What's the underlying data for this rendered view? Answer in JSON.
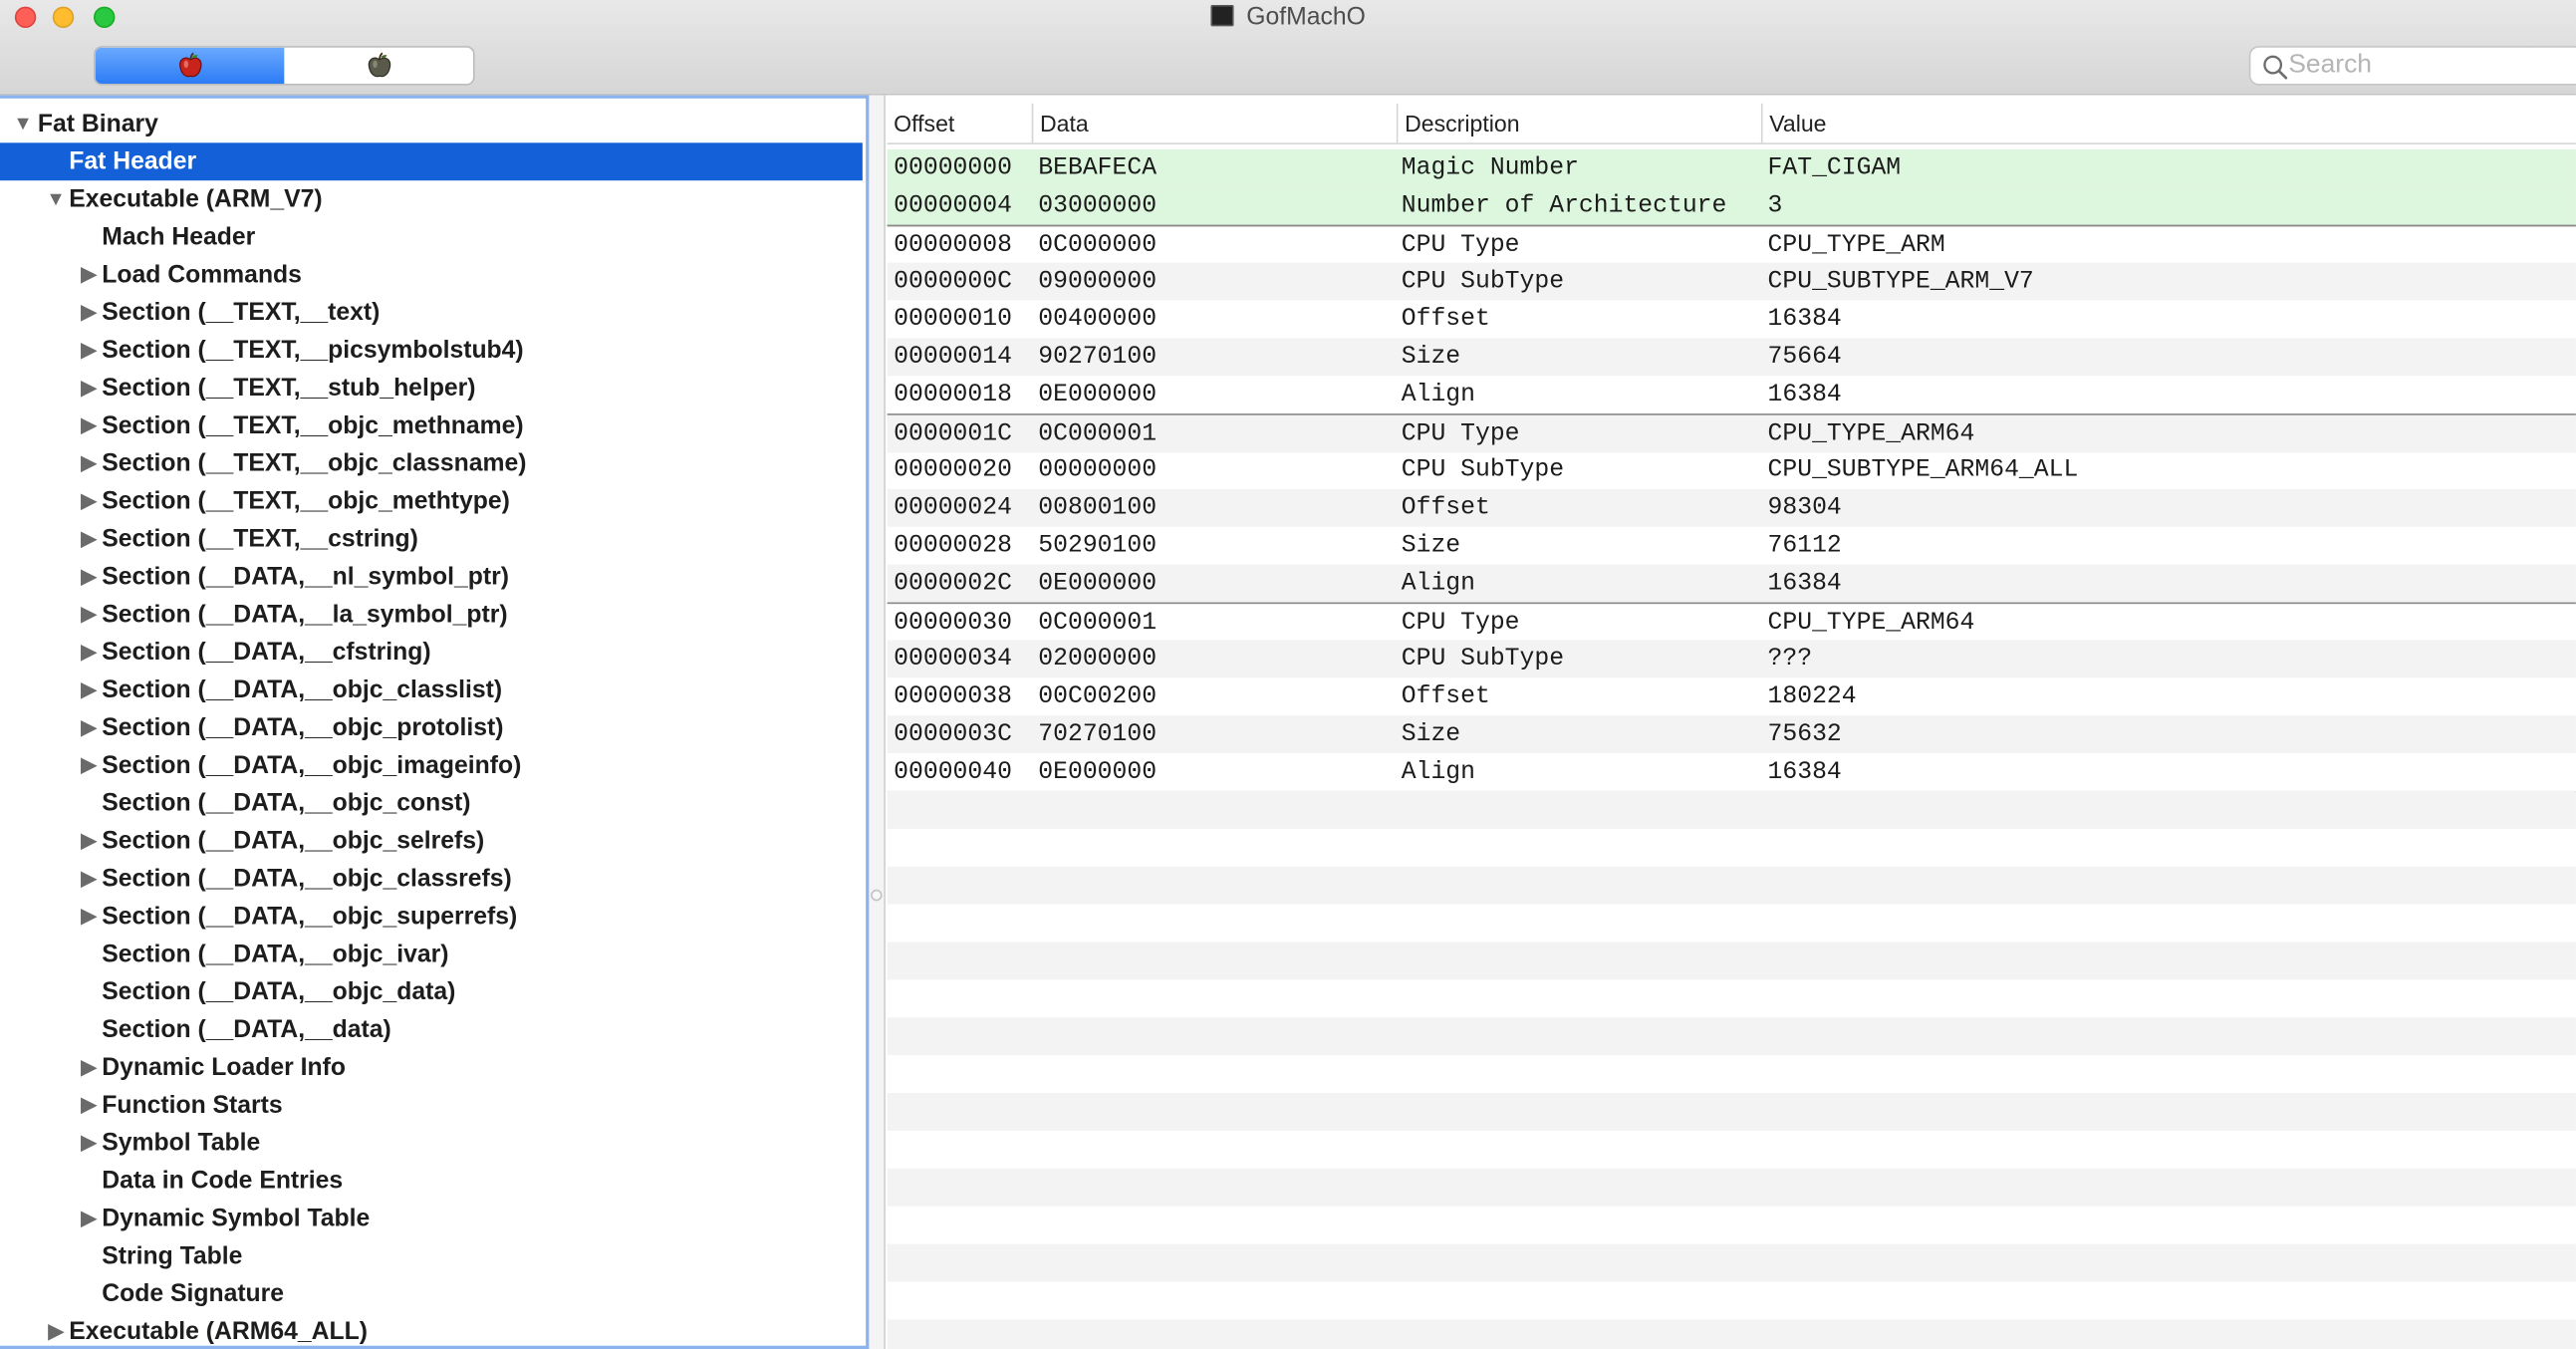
{
  "window": {
    "title": "GofMachO"
  },
  "toolbar": {
    "segments": [
      {
        "name": "red-apple-icon",
        "active": true
      },
      {
        "name": "dark-apple-icon",
        "active": false
      }
    ],
    "search": {
      "value": "",
      "placeholder": "Search"
    }
  },
  "colors": {
    "selection": "#1460d8",
    "highlight_row": "#dcf7dd",
    "segment_active": "#2c7cf6"
  },
  "tree": [
    {
      "label": "Fat Binary",
      "depth": 0,
      "disclosure": "expanded"
    },
    {
      "label": "Fat Header",
      "depth": 1,
      "disclosure": "none",
      "selected": true
    },
    {
      "label": "Executable  (ARM_V7)",
      "depth": 1,
      "disclosure": "expanded"
    },
    {
      "label": "Mach Header",
      "depth": 2,
      "disclosure": "none"
    },
    {
      "label": "Load Commands",
      "depth": 2,
      "disclosure": "collapsed"
    },
    {
      "label": "Section (__TEXT,__text)",
      "depth": 2,
      "disclosure": "collapsed"
    },
    {
      "label": "Section (__TEXT,__picsymbolstub4)",
      "depth": 2,
      "disclosure": "collapsed"
    },
    {
      "label": "Section (__TEXT,__stub_helper)",
      "depth": 2,
      "disclosure": "collapsed"
    },
    {
      "label": "Section (__TEXT,__objc_methname)",
      "depth": 2,
      "disclosure": "collapsed"
    },
    {
      "label": "Section (__TEXT,__objc_classname)",
      "depth": 2,
      "disclosure": "collapsed"
    },
    {
      "label": "Section (__TEXT,__objc_methtype)",
      "depth": 2,
      "disclosure": "collapsed"
    },
    {
      "label": "Section (__TEXT,__cstring)",
      "depth": 2,
      "disclosure": "collapsed"
    },
    {
      "label": "Section (__DATA,__nl_symbol_ptr)",
      "depth": 2,
      "disclosure": "collapsed"
    },
    {
      "label": "Section (__DATA,__la_symbol_ptr)",
      "depth": 2,
      "disclosure": "collapsed"
    },
    {
      "label": "Section (__DATA,__cfstring)",
      "depth": 2,
      "disclosure": "collapsed"
    },
    {
      "label": "Section (__DATA,__objc_classlist)",
      "depth": 2,
      "disclosure": "collapsed"
    },
    {
      "label": "Section (__DATA,__objc_protolist)",
      "depth": 2,
      "disclosure": "collapsed"
    },
    {
      "label": "Section (__DATA,__objc_imageinfo)",
      "depth": 2,
      "disclosure": "collapsed"
    },
    {
      "label": "Section (__DATA,__objc_const)",
      "depth": 2,
      "disclosure": "none"
    },
    {
      "label": "Section (__DATA,__objc_selrefs)",
      "depth": 2,
      "disclosure": "collapsed"
    },
    {
      "label": "Section (__DATA,__objc_classrefs)",
      "depth": 2,
      "disclosure": "collapsed"
    },
    {
      "label": "Section (__DATA,__objc_superrefs)",
      "depth": 2,
      "disclosure": "collapsed"
    },
    {
      "label": "Section (__DATA,__objc_ivar)",
      "depth": 2,
      "disclosure": "none"
    },
    {
      "label": "Section (__DATA,__objc_data)",
      "depth": 2,
      "disclosure": "none"
    },
    {
      "label": "Section (__DATA,__data)",
      "depth": 2,
      "disclosure": "none"
    },
    {
      "label": "Dynamic Loader Info",
      "depth": 2,
      "disclosure": "collapsed"
    },
    {
      "label": "Function Starts",
      "depth": 2,
      "disclosure": "collapsed"
    },
    {
      "label": "Symbol Table",
      "depth": 2,
      "disclosure": "collapsed"
    },
    {
      "label": "Data in Code Entries",
      "depth": 2,
      "disclosure": "none"
    },
    {
      "label": "Dynamic Symbol Table",
      "depth": 2,
      "disclosure": "collapsed"
    },
    {
      "label": "String Table",
      "depth": 2,
      "disclosure": "none"
    },
    {
      "label": "Code Signature",
      "depth": 2,
      "disclosure": "none"
    },
    {
      "label": "Executable  (ARM64_ALL)",
      "depth": 1,
      "disclosure": "collapsed"
    }
  ],
  "table": {
    "columns": [
      "Offset",
      "Data",
      "Description",
      "Value"
    ],
    "rows": [
      {
        "offset": "00000000",
        "data": "BEBAFECA",
        "description": "Magic Number",
        "value": "FAT_CIGAM",
        "highlight": true
      },
      {
        "offset": "00000004",
        "data": "03000000",
        "description": "Number of Architecture",
        "value": "3",
        "highlight": true
      },
      {
        "offset": "00000008",
        "data": "0C000000",
        "description": "CPU Type",
        "value": "CPU_TYPE_ARM"
      },
      {
        "offset": "0000000C",
        "data": "09000000",
        "description": "CPU SubType",
        "value": "CPU_SUBTYPE_ARM_V7"
      },
      {
        "offset": "00000010",
        "data": "00400000",
        "description": "Offset",
        "value": "16384"
      },
      {
        "offset": "00000014",
        "data": "90270100",
        "description": "Size",
        "value": "75664"
      },
      {
        "offset": "00000018",
        "data": "0E000000",
        "description": "Align",
        "value": "16384"
      },
      {
        "offset": "0000001C",
        "data": "0C000001",
        "description": "CPU Type",
        "value": "CPU_TYPE_ARM64"
      },
      {
        "offset": "00000020",
        "data": "00000000",
        "description": "CPU SubType",
        "value": "CPU_SUBTYPE_ARM64_ALL"
      },
      {
        "offset": "00000024",
        "data": "00800100",
        "description": "Offset",
        "value": "98304"
      },
      {
        "offset": "00000028",
        "data": "50290100",
        "description": "Size",
        "value": "76112"
      },
      {
        "offset": "0000002C",
        "data": "0E000000",
        "description": "Align",
        "value": "16384"
      },
      {
        "offset": "00000030",
        "data": "0C000001",
        "description": "CPU Type",
        "value": "CPU_TYPE_ARM64"
      },
      {
        "offset": "00000034",
        "data": "02000000",
        "description": "CPU SubType",
        "value": "???"
      },
      {
        "offset": "00000038",
        "data": "00C00200",
        "description": "Offset",
        "value": "180224"
      },
      {
        "offset": "0000003C",
        "data": "70270100",
        "description": "Size",
        "value": "75632"
      },
      {
        "offset": "00000040",
        "data": "0E000000",
        "description": "Align",
        "value": "16384"
      }
    ]
  }
}
